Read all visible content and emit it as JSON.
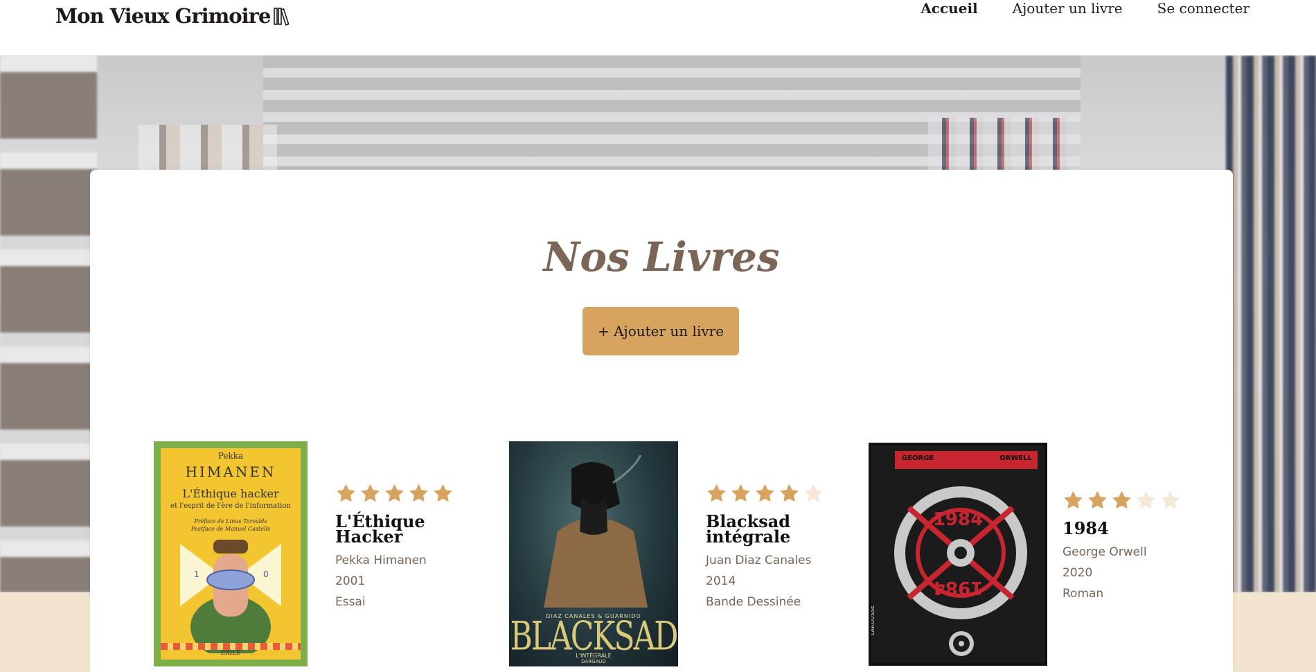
{
  "header": {
    "logo_text": "Mon Vieux Grimoire",
    "nav": [
      {
        "label": "Accueil",
        "active": true
      },
      {
        "label": "Ajouter un livre",
        "active": false
      },
      {
        "label": "Se connecter",
        "active": false
      }
    ]
  },
  "main": {
    "title": "Nos Livres",
    "add_button_label": "+ Ajouter un livre"
  },
  "books": [
    {
      "title": "L'Éthique Hacker",
      "author": "Pekka Himanen",
      "year": "2001",
      "genre": "Essai",
      "rating": 5,
      "cover": {
        "author_first": "Pekka",
        "author_last": "HIMANEN",
        "title": "L'Éthique hacker",
        "subtitle": "et l'esprit de l'ère de l'information",
        "preface": "Préface de Linus Torvalds",
        "postface": "Postface de Manuel Castells",
        "publisher": "EXILS"
      }
    },
    {
      "title": "Blacksad intégrale",
      "author": "Juan Diaz Canales",
      "year": "2014",
      "genre": "Bande Dessinée",
      "rating": 4,
      "cover": {
        "authors": "DIAZ CANALES & GUARNIDO",
        "title": "BLACKSAD",
        "subtitle": "L'INTÉGRALE",
        "publisher": "DARGAUD"
      }
    },
    {
      "title": "1984",
      "author": "George Orwell",
      "year": "2020",
      "genre": "Roman",
      "rating": 3,
      "cover": {
        "author_first": "GEORGE",
        "author_last": "ORWELL",
        "number": "1984",
        "publisher": "LAROUSSE"
      }
    }
  ],
  "colors": {
    "accent": "#d6a45f",
    "title_brown": "#7a6557",
    "star_filled": "#d6a45f",
    "star_empty": "#f5e8d8",
    "cream_band": "#f3e4d0"
  }
}
